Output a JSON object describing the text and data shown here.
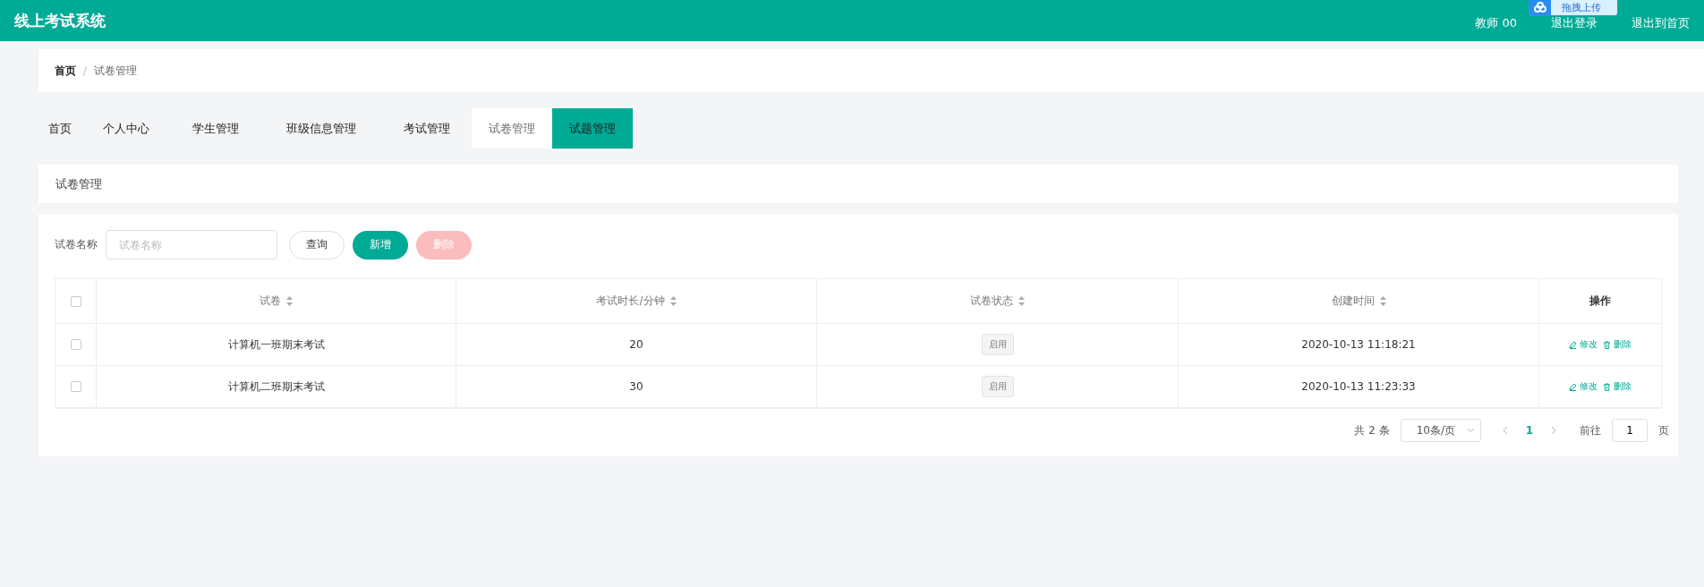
{
  "header": {
    "title": "线上考试系统",
    "user": "教师 00",
    "upload_widget": "拖拽上传",
    "links": [
      "退出登录",
      "退出到首页"
    ]
  },
  "breadcrumb": [
    "首页",
    "试卷管理"
  ],
  "breadcrumb_separator": "/",
  "tabs": [
    {
      "label": "首页",
      "selected": false,
      "hovered": false
    },
    {
      "label": "个人中心",
      "selected": false,
      "hovered": false
    },
    {
      "label": "学生管理",
      "selected": false,
      "hovered": false
    },
    {
      "label": "班级信息管理",
      "selected": false,
      "hovered": false
    },
    {
      "label": "考试管理",
      "selected": false,
      "hovered": false
    },
    {
      "label": "试卷管理",
      "selected": true,
      "hovered": false
    },
    {
      "label": "试题管理",
      "selected": false,
      "hovered": true
    }
  ],
  "section_title": "试卷管理",
  "filter": {
    "label": "试卷名称",
    "placeholder": "试卷名称",
    "buttons": [
      {
        "label": "查询",
        "kind": "plain",
        "disabled": false
      },
      {
        "label": "新增",
        "kind": "primary",
        "disabled": false
      },
      {
        "label": "删除",
        "kind": "danger",
        "disabled": true
      }
    ]
  },
  "table": {
    "all_checked": false,
    "columns": [
      {
        "label": "试卷",
        "sortable": true
      },
      {
        "label": "考试时长/分钟",
        "sortable": true
      },
      {
        "label": "试卷状态",
        "sortable": true
      },
      {
        "label": "创建时间",
        "sortable": true
      },
      {
        "label": "操作",
        "sortable": false
      }
    ],
    "rows": [
      {
        "checked": false,
        "name": "计算机一班期末考试",
        "duration": "20",
        "status": "启用",
        "created": "2020-10-13 11:18:21",
        "actions": [
          "修改",
          "删除"
        ]
      },
      {
        "checked": false,
        "name": "计算机二班期末考试",
        "duration": "30",
        "status": "启用",
        "created": "2020-10-13 11:23:33",
        "actions": [
          "修改",
          "删除"
        ]
      }
    ]
  },
  "pagination": {
    "total": "共 2 条",
    "page_size": "10条/页",
    "pages": [
      {
        "label": "1",
        "selected": true
      }
    ],
    "goto_label": "前往",
    "goto_value": "1",
    "goto_suffix": "页"
  }
}
